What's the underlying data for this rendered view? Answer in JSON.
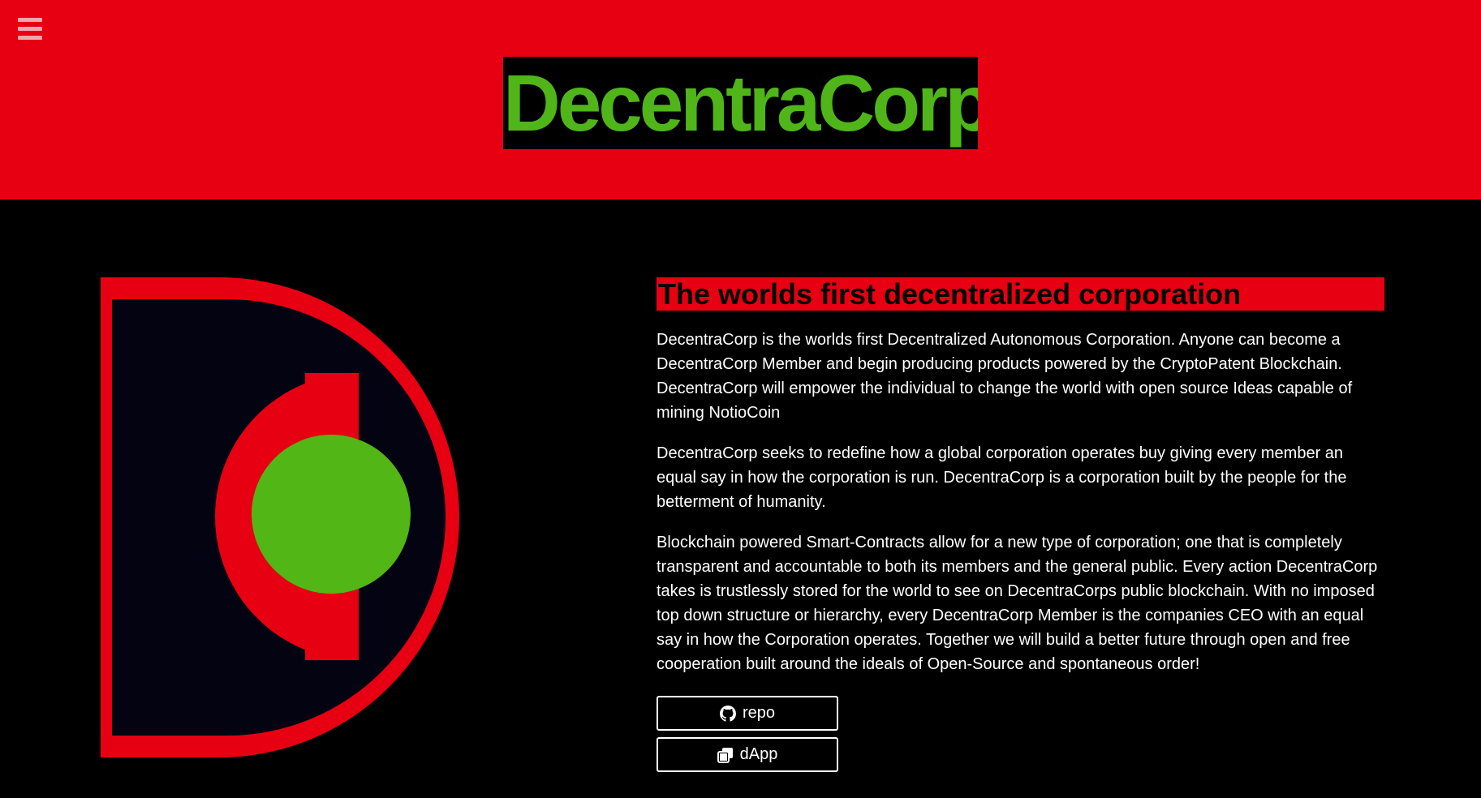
{
  "header": {
    "brand": "DecentraCorp",
    "menu_icon": "hamburger-menu-icon"
  },
  "colors": {
    "header_bg": "#e60012",
    "brand_text": "#4fb519",
    "page_bg": "#000000",
    "logo_red": "#e60012",
    "logo_navy": "#030312",
    "logo_green": "#52b616"
  },
  "content": {
    "headline": "The worlds first decentralized corporation",
    "paragraphs": [
      "DecentraCorp is the worlds first Decentralized Autonomous Corporation. Anyone can become a DecentraCorp Member and begin producing products powered by the CryptoPatent Blockchain. DecentraCorp will empower the individual to change the world with open source Ideas capable of mining NotioCoin",
      "DecentraCorp seeks to redefine how a global corporation operates buy giving every member an equal say in how the corporation is run. DecentraCorp is a corporation built by the people for the betterment of humanity.",
      "Blockchain powered Smart-Contracts allow for a new type of corporation; one that is completely transparent and accountable to both its members and the general public. Every action DecentraCorp takes is trustlessly stored for the world to see on DecentraCorps public blockchain. With no imposed top down structure or hierarchy, every DecentraCorp Member is the companies CEO with an equal say in how the Corporation operates. Together we will build a better future through open and free cooperation built around the ideals of Open-Source and spontaneous order!"
    ]
  },
  "buttons": {
    "repo_label": "repo",
    "repo_icon": "github-icon",
    "dapp_label": "dApp",
    "dapp_icon": "clone-icon"
  }
}
